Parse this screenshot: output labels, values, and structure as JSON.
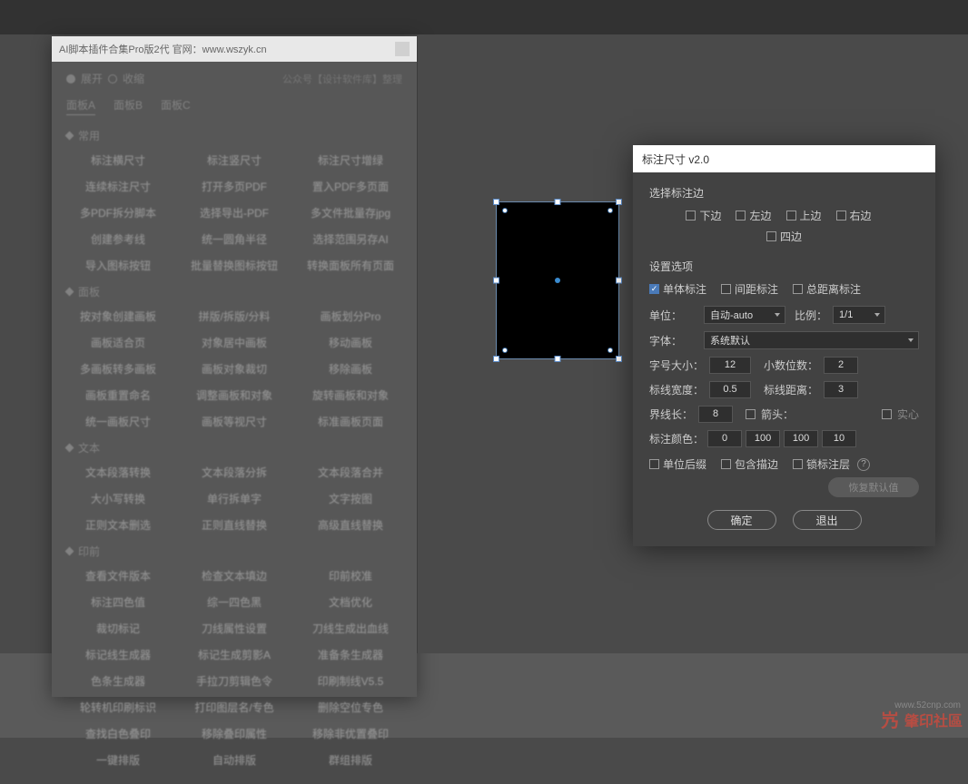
{
  "topbar": {},
  "leftPanel": {
    "title": "AI脚本插件合集Pro版2代 官网：www.wszyk.cn",
    "radio": {
      "expand": "展开",
      "collapse": "收缩"
    },
    "credit": "公众号【设计软件库】整理",
    "tabs": [
      "面板A",
      "面板B",
      "面板C"
    ],
    "sections": [
      {
        "name": "常用",
        "items": [
          "标注横尺寸",
          "标注竖尺寸",
          "标注尺寸增绿",
          "连续标注尺寸",
          "打开多页PDF",
          "置入PDF多页面",
          "多PDF拆分脚本",
          "选择导出-PDF",
          "多文件批量存jpg",
          "创建参考线",
          "统一圆角半径",
          "选择范围另存AI",
          "导入图标按钮",
          "批量替换图标按钮",
          "转换面板所有页面"
        ]
      },
      {
        "name": "面板",
        "items": [
          "按对象创建画板",
          "拼版/拆版/分料",
          "画板划分Pro",
          "画板适合页",
          "对象居中画板",
          "移动画板",
          "多画板转多画板",
          "画板对象裁切",
          "移除画板",
          "画板重置命名",
          "调整画板和对象",
          "旋转画板和对象",
          "统一画板尺寸",
          "画板等视尺寸",
          "标准画板页面"
        ]
      },
      {
        "name": "文本",
        "items": [
          "文本段落转换",
          "文本段落分拆",
          "文本段落合并",
          "大小写转换",
          "单行拆单字",
          "文字按图",
          "正则文本删选",
          "正则直线替换",
          "高级直线替换"
        ]
      },
      {
        "name": "印前",
        "items": [
          "查看文件版本",
          "检查文本填边",
          "印前校准",
          "标注四色值",
          "综一四色黑",
          "文档优化",
          "裁切标记",
          "刀线属性设置",
          "刀线生成出血线",
          "标记线生成器",
          "标记生成剪影A",
          "准备条生成器",
          "色条生成器",
          "手拉刀剪辑色令",
          "印刷制线V5.5",
          "轮转机印刷标识",
          "打印图层名/专色",
          "删除空位专色",
          "查找白色叠印",
          "移除叠印属性",
          "移除非优置叠印",
          "一键排版",
          "自动排版",
          "群组排版"
        ]
      }
    ]
  },
  "dialog": {
    "title": "标注尺寸 v2.0",
    "section1": "选择标注边",
    "edges": {
      "bottom": "下边",
      "left": "左边",
      "top": "上边",
      "right": "右边",
      "all": "四边"
    },
    "section2": "设置选项",
    "modes": {
      "single": "单体标注",
      "gap": "间距标注",
      "total": "总距离标注"
    },
    "unit": {
      "label": "单位：",
      "value": "自动-auto"
    },
    "ratio": {
      "label": "比例：",
      "value": "1/1"
    },
    "font": {
      "label": "字体：",
      "value": "系统默认"
    },
    "fontSize": {
      "label": "字号大小：",
      "value": "12"
    },
    "decimals": {
      "label": "小数位数：",
      "value": "2"
    },
    "lineWidth": {
      "label": "标线宽度：",
      "value": "0.5"
    },
    "lineDist": {
      "label": "标线距离：",
      "value": "3"
    },
    "boundLen": {
      "label": "界线长：",
      "value": "8"
    },
    "arrow": {
      "label": "箭头：",
      "solid": "实心"
    },
    "color": {
      "label": "标注颜色：",
      "c": "0",
      "m": "100",
      "y": "100",
      "k": "10"
    },
    "opts": {
      "unitSuffix": "单位后缀",
      "includeStroke": "包含描边",
      "lockLayer": "锁标注层"
    },
    "reset": "恢复默认值",
    "ok": "确定",
    "cancel": "退出"
  },
  "watermark": {
    "text": "肇印社區",
    "url": "www.52cnp.com"
  }
}
